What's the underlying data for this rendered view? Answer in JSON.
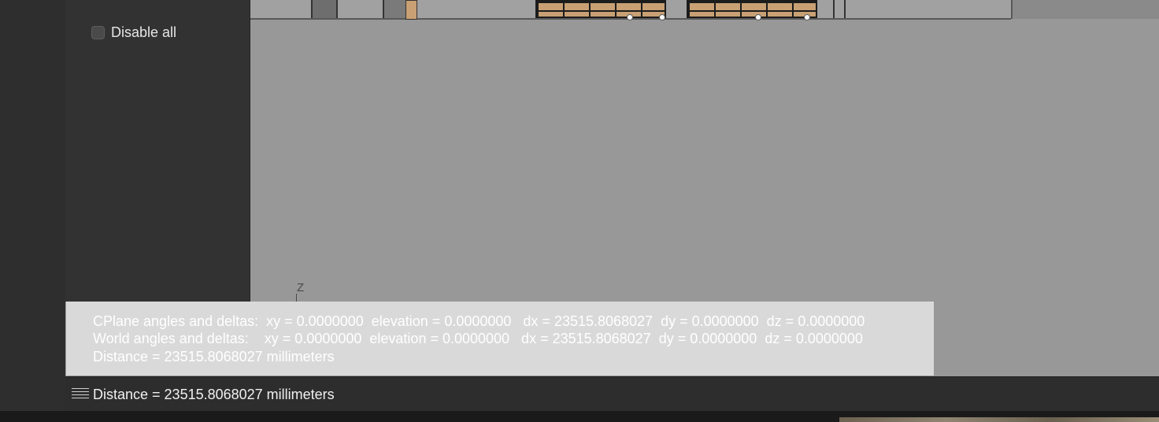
{
  "sidepanel": {
    "disable_all_label": "Disable all",
    "disable_all_checked": false
  },
  "viewport": {
    "axis_label": "Z"
  },
  "history": {
    "lines": [
      "CPlane angles and deltas:  xy = 0.0000000  elevation = 0.0000000   dx = 23515.8068027  dy = 0.0000000  dz = 0.0000000",
      "World angles and deltas:    xy = 0.0000000  elevation = 0.0000000   dx = 23515.8068027  dy = 0.0000000  dz = 0.0000000",
      "Distance = 23515.8068027 millimeters"
    ]
  },
  "command": {
    "text": "Distance = 23515.8068027 millimeters",
    "icon": "menu-icon"
  },
  "colors": {
    "panel": "#323232",
    "viewport": "#989898",
    "history_bg": "#d9d9d9",
    "wood": "#c8a073"
  }
}
